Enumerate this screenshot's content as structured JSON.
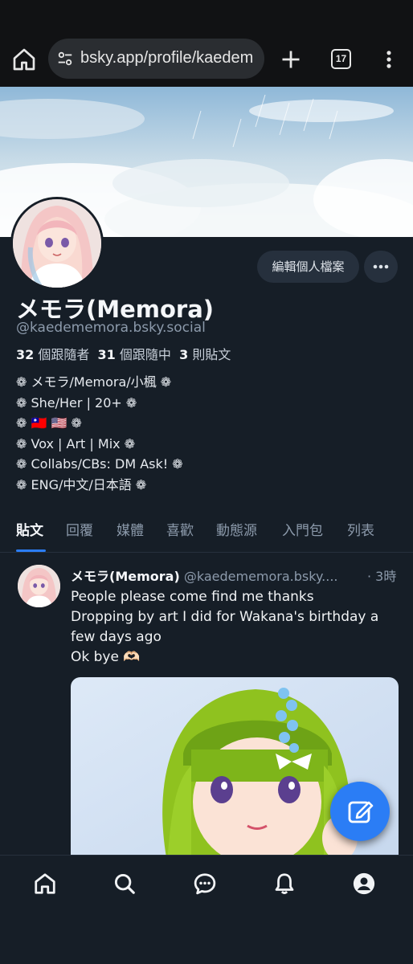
{
  "browser": {
    "url": "bsky.app/profile/kaedem",
    "tab_count": "17",
    "icons": [
      "home-icon",
      "site-settings-icon",
      "new-tab-icon",
      "tab-switcher-icon",
      "overflow-menu-icon"
    ]
  },
  "profile": {
    "display_name": "メモラ(Memora)",
    "handle": "@kaedememora.bsky.social",
    "edit_button": "編輯個人檔案",
    "stats": {
      "followers_count": "32",
      "followers_label": "個跟隨者",
      "following_count": "31",
      "following_label": "個跟隨中",
      "posts_count": "3",
      "posts_label": "則貼文"
    },
    "bio": [
      "❁ メモラ/Memora/小楓 ❁",
      "❁ She/Her | 20+ ❁",
      "❁ 🇹🇼 🇺🇸 ❁",
      "❁ Vox | Art | Mix ❁",
      "❁ Collabs/CBs: DM Ask! ❁",
      "❁ ENG/中文/日本語 ❁"
    ]
  },
  "tabs": [
    "貼文",
    "回覆",
    "媒體",
    "喜歡",
    "動態源",
    "入門包",
    "列表"
  ],
  "active_tab": "貼文",
  "post": {
    "author": "メモラ(Memora)",
    "handle": "@kaedememora.bsky....",
    "time": "· 3時",
    "text": [
      "People please come find me thanks",
      "Dropping by art I did for Wakana's birthday a",
      "few days ago",
      "Ok bye 🫶🏻"
    ]
  },
  "bottom_nav": [
    "home-icon",
    "search-icon",
    "chat-icon",
    "notifications-icon",
    "profile-icon"
  ],
  "colors": {
    "background": "#161e27",
    "accent": "#2b7df5",
    "muted_text": "#8c9aab",
    "button_bg": "#26303d"
  }
}
